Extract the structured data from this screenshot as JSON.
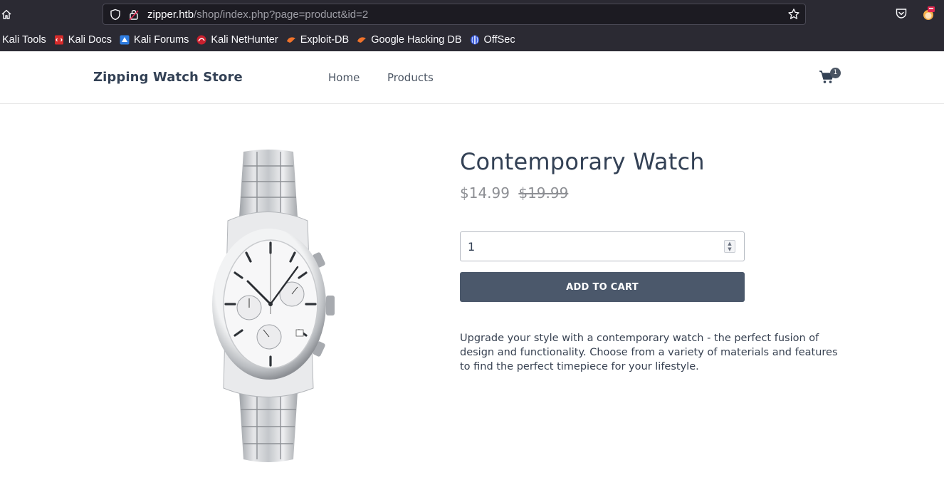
{
  "browser": {
    "url_host": "zipper.htb",
    "url_path": "/shop/index.php?page=product&id=2",
    "bookmarks": [
      {
        "label": "Kali Tools",
        "icon": "kali-tools-icon"
      },
      {
        "label": "Kali Docs",
        "icon": "kali-docs-icon"
      },
      {
        "label": "Kali Forums",
        "icon": "kali-forums-icon"
      },
      {
        "label": "Kali NetHunter",
        "icon": "kali-nethunter-icon"
      },
      {
        "label": "Exploit-DB",
        "icon": "exploit-db-icon"
      },
      {
        "label": "Google Hacking DB",
        "icon": "ghdb-icon"
      },
      {
        "label": "OffSec",
        "icon": "offsec-icon"
      }
    ]
  },
  "navbar": {
    "brand": "Zipping Watch Store",
    "links": [
      "Home",
      "Products"
    ],
    "cart_count": "1"
  },
  "product": {
    "title": "Contemporary Watch",
    "price": "$14.99",
    "old_price": "$19.99",
    "quantity": "1",
    "add_button": "ADD TO CART",
    "description": "Upgrade your style with a contemporary watch - the perfect fusion of design and functionality. Choose from a variety of materials and features to find the perfect timepiece for your lifestyle."
  },
  "colors": {
    "chrome_bg": "#2b2a33",
    "brand_text": "#334155",
    "button_bg": "#4b586b",
    "price_text": "#8d8f94"
  }
}
